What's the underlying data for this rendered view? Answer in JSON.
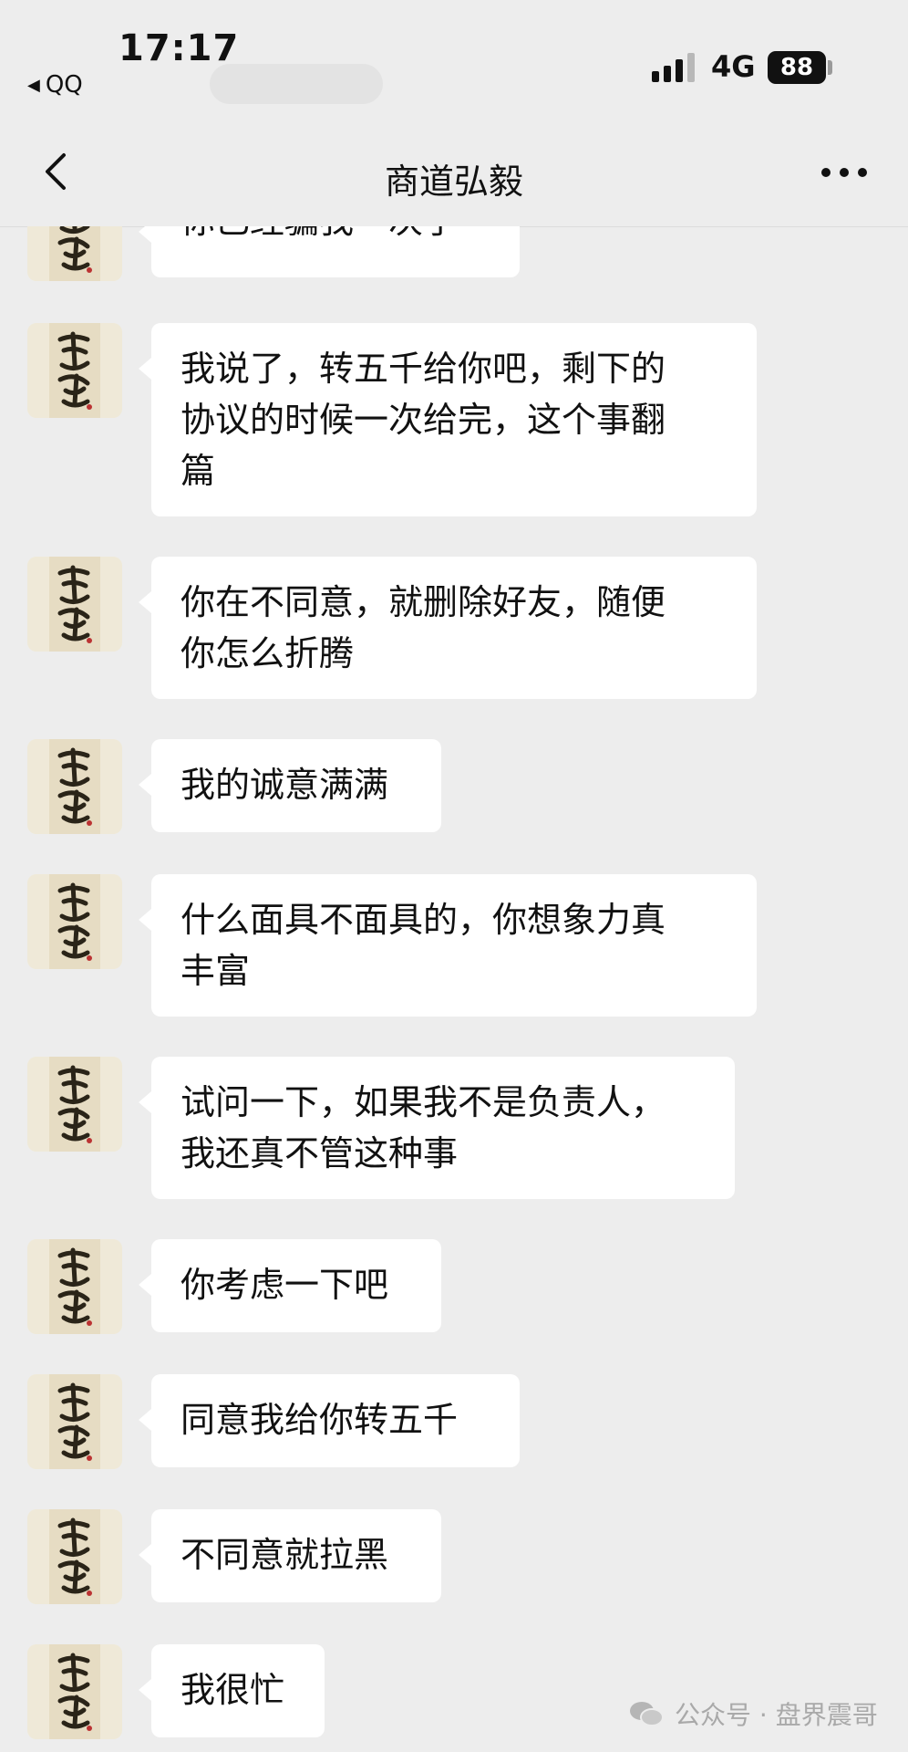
{
  "status_bar": {
    "time": "17:17",
    "back_app": "QQ",
    "network": "4G",
    "battery": "88"
  },
  "nav": {
    "title": "商道弘毅"
  },
  "messages": [
    {
      "text": "你已经骗我一次了"
    },
    {
      "text": "我说了，转五千给你吧，剩下的\n协议的时候一次给完，这个事翻\n篇"
    },
    {
      "text": "你在不同意，就删除好友，随便\n你怎么折腾"
    },
    {
      "text": "我的诚意满满"
    },
    {
      "text": "什么面具不面具的，你想象力真\n丰富"
    },
    {
      "text": "试问一下，如果我不是负责人，\n我还真不管这种事"
    },
    {
      "text": "你考虑一下吧"
    },
    {
      "text": "同意我给你转五千"
    },
    {
      "text": "不同意就拉黑"
    },
    {
      "text": "我很忙"
    }
  ],
  "watermark": {
    "text": "公众号 · 盘界震哥"
  },
  "colors": {
    "background": "#ededed",
    "bubble": "#ffffff",
    "text": "#111111"
  }
}
